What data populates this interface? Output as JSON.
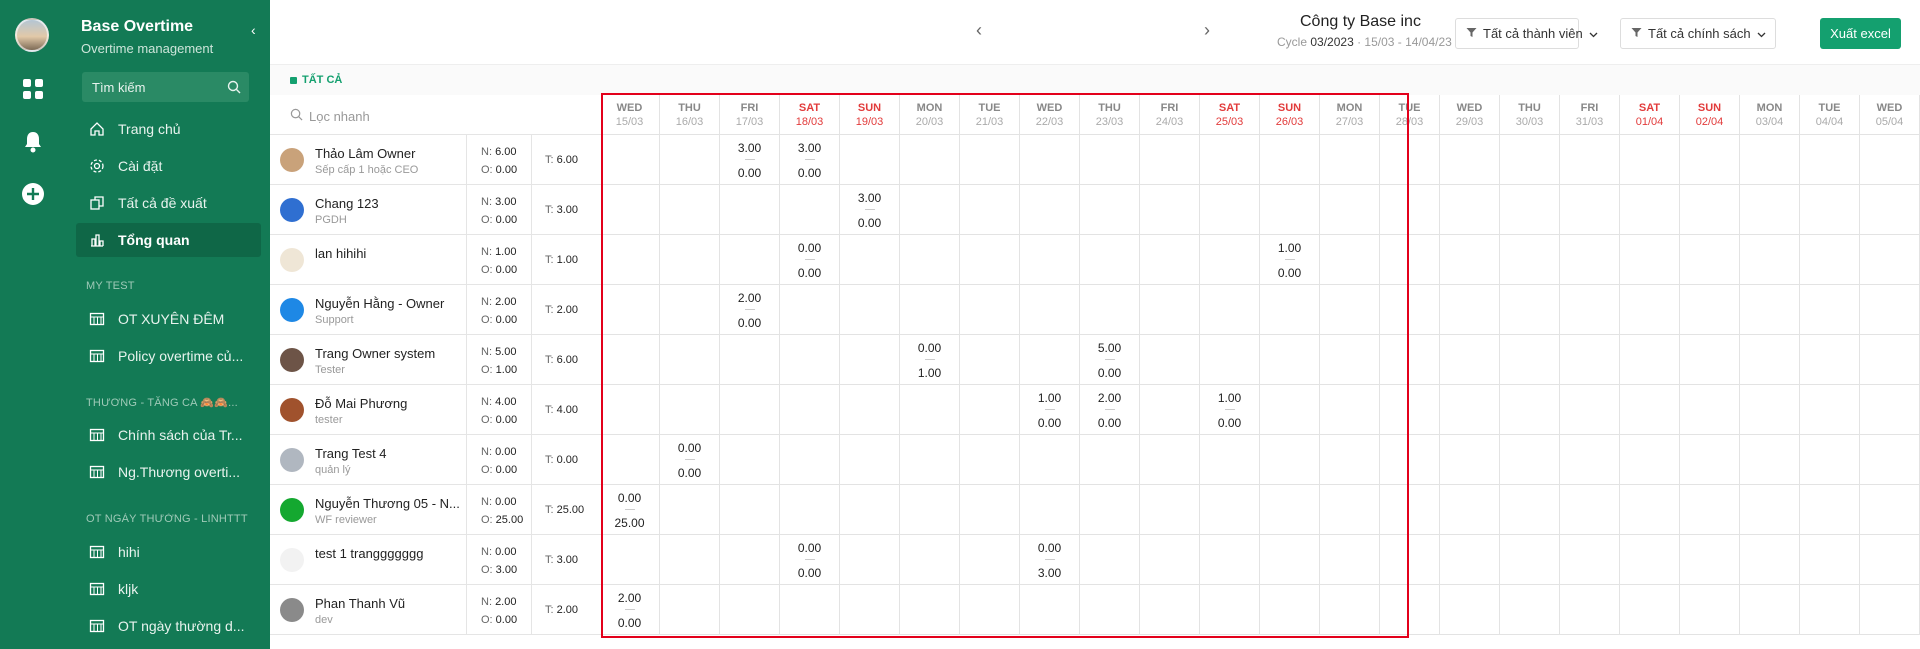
{
  "app": {
    "name": "Base Overtime",
    "subtitle": "Overtime management",
    "search_label": "Tìm kiếm"
  },
  "nav": [
    {
      "label": "Trang chủ",
      "icon": "home-icon"
    },
    {
      "label": "Cài đặt",
      "icon": "gear-icon"
    },
    {
      "label": "Tất cả đề xuất",
      "icon": "copy-icon"
    },
    {
      "label": "Tổng quan",
      "icon": "bar-chart-icon",
      "active": true
    }
  ],
  "groups": [
    {
      "title": "MY TEST",
      "items": [
        "OT XUYÊN ĐÊM",
        "Policy overtime củ..."
      ]
    },
    {
      "title": "THƯƠNG - TĂNG CA 🙈🙈...",
      "items": [
        "Chính sách của Tr...",
        "Ng.Thương overti..."
      ]
    },
    {
      "title": "OT NGÀY THƯỜNG - LINHTTT",
      "items": [
        "hihi",
        "kljk",
        "OT ngày thường d..."
      ]
    }
  ],
  "header": {
    "company": "Công ty Base inc",
    "cycle_prefix": "Cycle",
    "cycle": "03/2023",
    "cycle_range": "· 15/03 - 14/04/23",
    "member_filter": "Tất cả thành viên",
    "policy_filter": "Tất cả chính sách",
    "export_label": "Xuất excel"
  },
  "filter_tag": "TẤT CẢ",
  "quick_search": "Lọc nhanh",
  "days": [
    {
      "dow": "WED",
      "date": "15/03",
      "weekend": false
    },
    {
      "dow": "THU",
      "date": "16/03",
      "weekend": false
    },
    {
      "dow": "FRI",
      "date": "17/03",
      "weekend": false
    },
    {
      "dow": "SAT",
      "date": "18/03",
      "weekend": true
    },
    {
      "dow": "SUN",
      "date": "19/03",
      "weekend": true
    },
    {
      "dow": "MON",
      "date": "20/03",
      "weekend": false
    },
    {
      "dow": "TUE",
      "date": "21/03",
      "weekend": false
    },
    {
      "dow": "WED",
      "date": "22/03",
      "weekend": false
    },
    {
      "dow": "THU",
      "date": "23/03",
      "weekend": false
    },
    {
      "dow": "FRI",
      "date": "24/03",
      "weekend": false
    },
    {
      "dow": "SAT",
      "date": "25/03",
      "weekend": true
    },
    {
      "dow": "SUN",
      "date": "26/03",
      "weekend": true
    },
    {
      "dow": "MON",
      "date": "27/03",
      "weekend": false
    },
    {
      "dow": "TUE",
      "date": "28/03",
      "weekend": false
    },
    {
      "dow": "WED",
      "date": "29/03",
      "weekend": false
    },
    {
      "dow": "THU",
      "date": "30/03",
      "weekend": false
    },
    {
      "dow": "FRI",
      "date": "31/03",
      "weekend": false
    },
    {
      "dow": "SAT",
      "date": "01/04",
      "weekend": true
    },
    {
      "dow": "SUN",
      "date": "02/04",
      "weekend": true
    },
    {
      "dow": "MON",
      "date": "03/04",
      "weekend": false
    },
    {
      "dow": "TUE",
      "date": "04/04",
      "weekend": false
    },
    {
      "dow": "WED",
      "date": "05/04",
      "weekend": false
    }
  ],
  "employees": [
    {
      "name": "Thảo Lâm Owner",
      "role": "Sếp cấp 1 hoặc CEO",
      "n": "6.00",
      "o": "0.00",
      "t": "6.00",
      "avatar": "#c9a27a",
      "entries": [
        {
          "day": 2,
          "n": "3.00",
          "o": "0.00"
        },
        {
          "day": 3,
          "n": "3.00",
          "o": "0.00"
        }
      ]
    },
    {
      "name": "Chang 123",
      "role": "PGDH",
      "n": "3.00",
      "o": "0.00",
      "t": "3.00",
      "avatar": "#2f6fd1",
      "entries": [
        {
          "day": 4,
          "n": "3.00",
          "o": "0.00"
        }
      ]
    },
    {
      "name": "lan hihihi",
      "role": "",
      "n": "1.00",
      "o": "0.00",
      "t": "1.00",
      "avatar": "#efe6d6",
      "entries": [
        {
          "day": 3,
          "n": "0.00",
          "o": "0.00"
        },
        {
          "day": 11,
          "n": "1.00",
          "o": "0.00"
        }
      ]
    },
    {
      "name": "Nguyễn Hằng - Owner",
      "role": "Support",
      "n": "2.00",
      "o": "0.00",
      "t": "2.00",
      "avatar": "#1e88e5",
      "entries": [
        {
          "day": 2,
          "n": "2.00",
          "o": "0.00"
        }
      ]
    },
    {
      "name": "Trang Owner system",
      "role": "Tester",
      "n": "5.00",
      "o": "1.00",
      "t": "6.00",
      "avatar": "#6d5447",
      "entries": [
        {
          "day": 5,
          "n": "0.00",
          "o": "1.00"
        },
        {
          "day": 8,
          "n": "5.00",
          "o": "0.00"
        }
      ]
    },
    {
      "name": "Đỗ Mai Phương",
      "role": "tester",
      "n": "4.00",
      "o": "0.00",
      "t": "4.00",
      "avatar": "#a0522d",
      "entries": [
        {
          "day": 7,
          "n": "1.00",
          "o": "0.00"
        },
        {
          "day": 8,
          "n": "2.00",
          "o": "0.00"
        },
        {
          "day": 10,
          "n": "1.00",
          "o": "0.00"
        }
      ]
    },
    {
      "name": "Trang Test 4",
      "role": "quản lý",
      "n": "0.00",
      "o": "0.00",
      "t": "0.00",
      "avatar": "#b0b7c0",
      "entries": [
        {
          "day": 1,
          "n": "0.00",
          "o": "0.00"
        }
      ]
    },
    {
      "name": "Nguyễn Thương 05 - N...",
      "role": "WF reviewer",
      "n": "0.00",
      "o": "25.00",
      "t": "25.00",
      "avatar": "#14a830",
      "entries": [
        {
          "day": 0,
          "n": "0.00",
          "o": "25.00"
        }
      ]
    },
    {
      "name": "test 1 tranggggggg",
      "role": "",
      "n": "0.00",
      "o": "3.00",
      "t": "3.00",
      "avatar": "#f2f2f2",
      "entries": [
        {
          "day": 3,
          "n": "0.00",
          "o": "0.00"
        },
        {
          "day": 7,
          "n": "0.00",
          "o": "3.00"
        }
      ]
    },
    {
      "name": "Phan Thanh Vũ",
      "role": "dev",
      "n": "2.00",
      "o": "0.00",
      "t": "2.00",
      "avatar": "#8a8a8a",
      "entries": [
        {
          "day": 0,
          "n": "2.00",
          "o": "0.00"
        }
      ]
    }
  ],
  "labels": {
    "n": "N:",
    "o": "O:",
    "t": "T:"
  }
}
